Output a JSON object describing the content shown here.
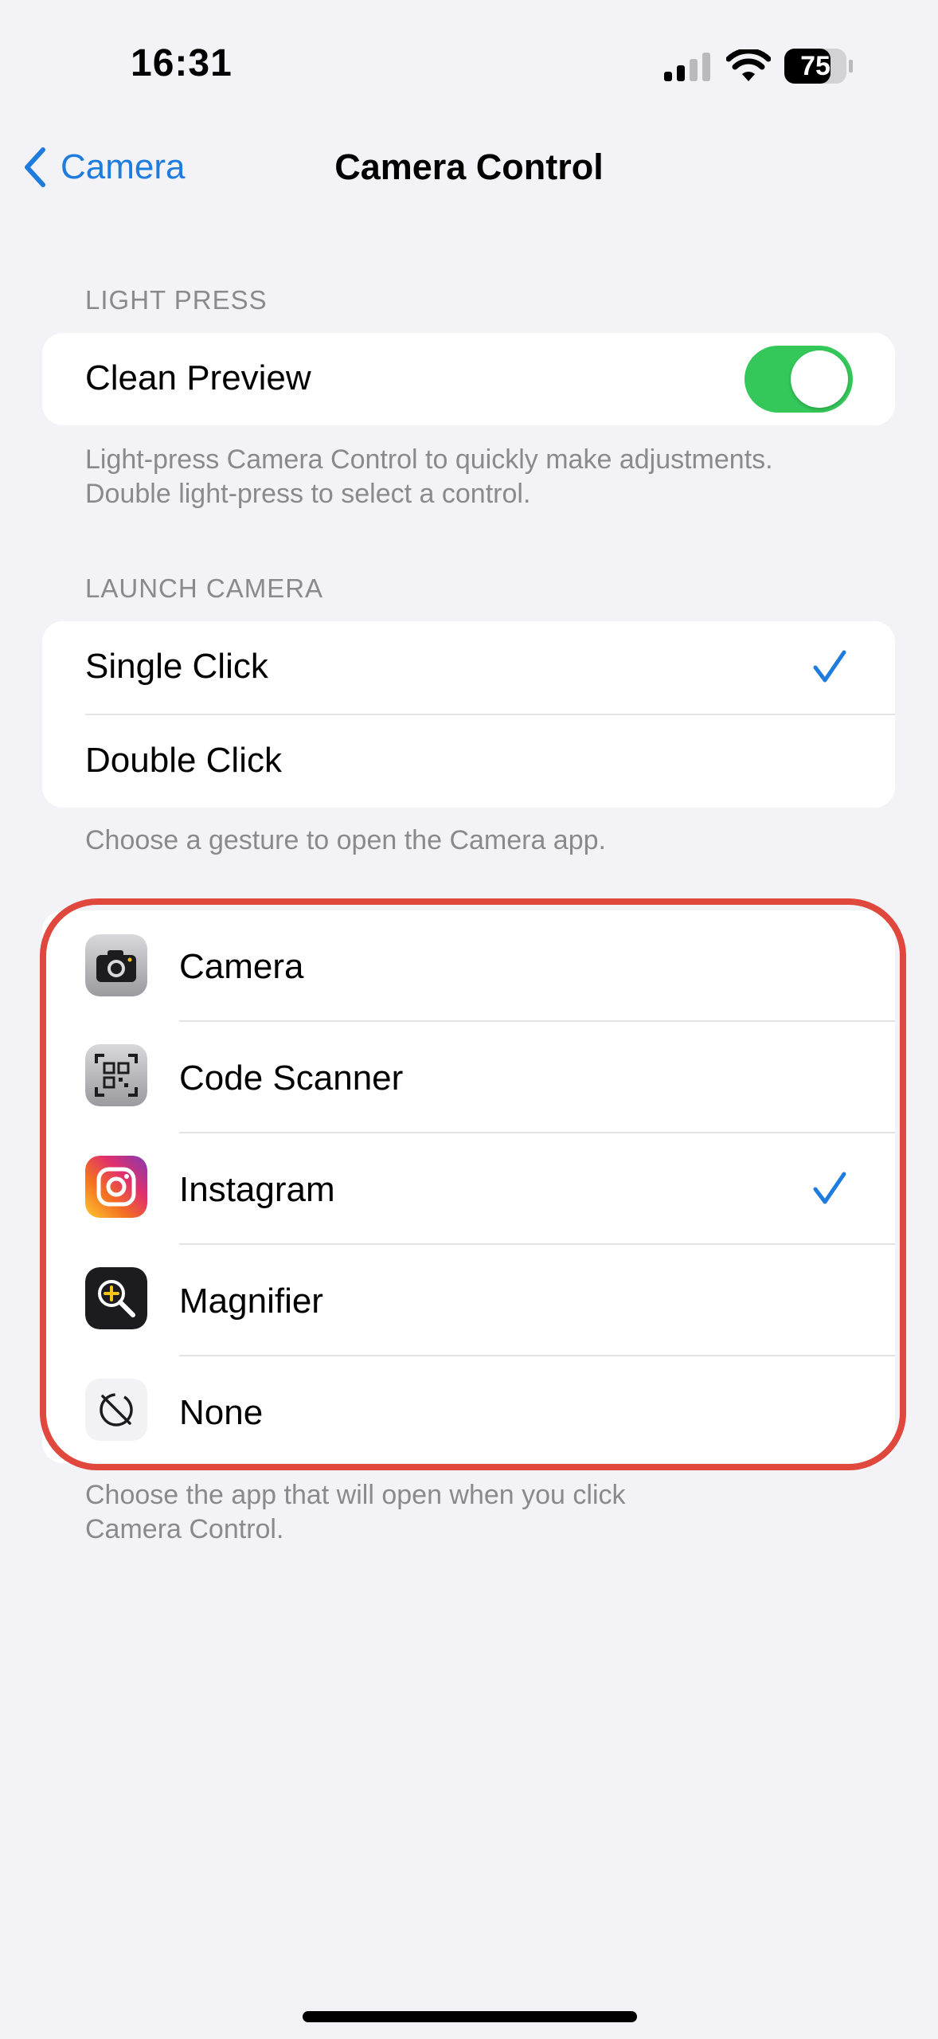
{
  "status_bar": {
    "time": "16:31",
    "battery": "75"
  },
  "nav": {
    "back_label": "Camera",
    "title": "Camera Control"
  },
  "light_press": {
    "header": "LIGHT PRESS",
    "clean_preview_label": "Clean Preview",
    "clean_preview_on": true,
    "footer_line1": "Light-press Camera Control to quickly make adjustments.",
    "footer_line2": "Double light-press to select a control."
  },
  "launch_camera": {
    "header": "LAUNCH CAMERA",
    "options": [
      "Single Click",
      "Double Click"
    ],
    "selected": "Single Click",
    "footer": "Choose a gesture to open the Camera app."
  },
  "apps": {
    "items": [
      {
        "label": "Camera",
        "icon": "camera-app-icon"
      },
      {
        "label": "Code Scanner",
        "icon": "code-scanner-app-icon"
      },
      {
        "label": "Instagram",
        "icon": "instagram-app-icon"
      },
      {
        "label": "Magnifier",
        "icon": "magnifier-app-icon"
      },
      {
        "label": "None",
        "icon": "none-icon"
      }
    ],
    "selected": "Instagram",
    "footer_line1": "Choose the app that will open when you click",
    "footer_line2": "Camera Control."
  },
  "colors": {
    "accent": "#1E7CDF",
    "toggle_on": "#34C759",
    "highlight": "#E0473D",
    "background": "#F2F2F7"
  }
}
